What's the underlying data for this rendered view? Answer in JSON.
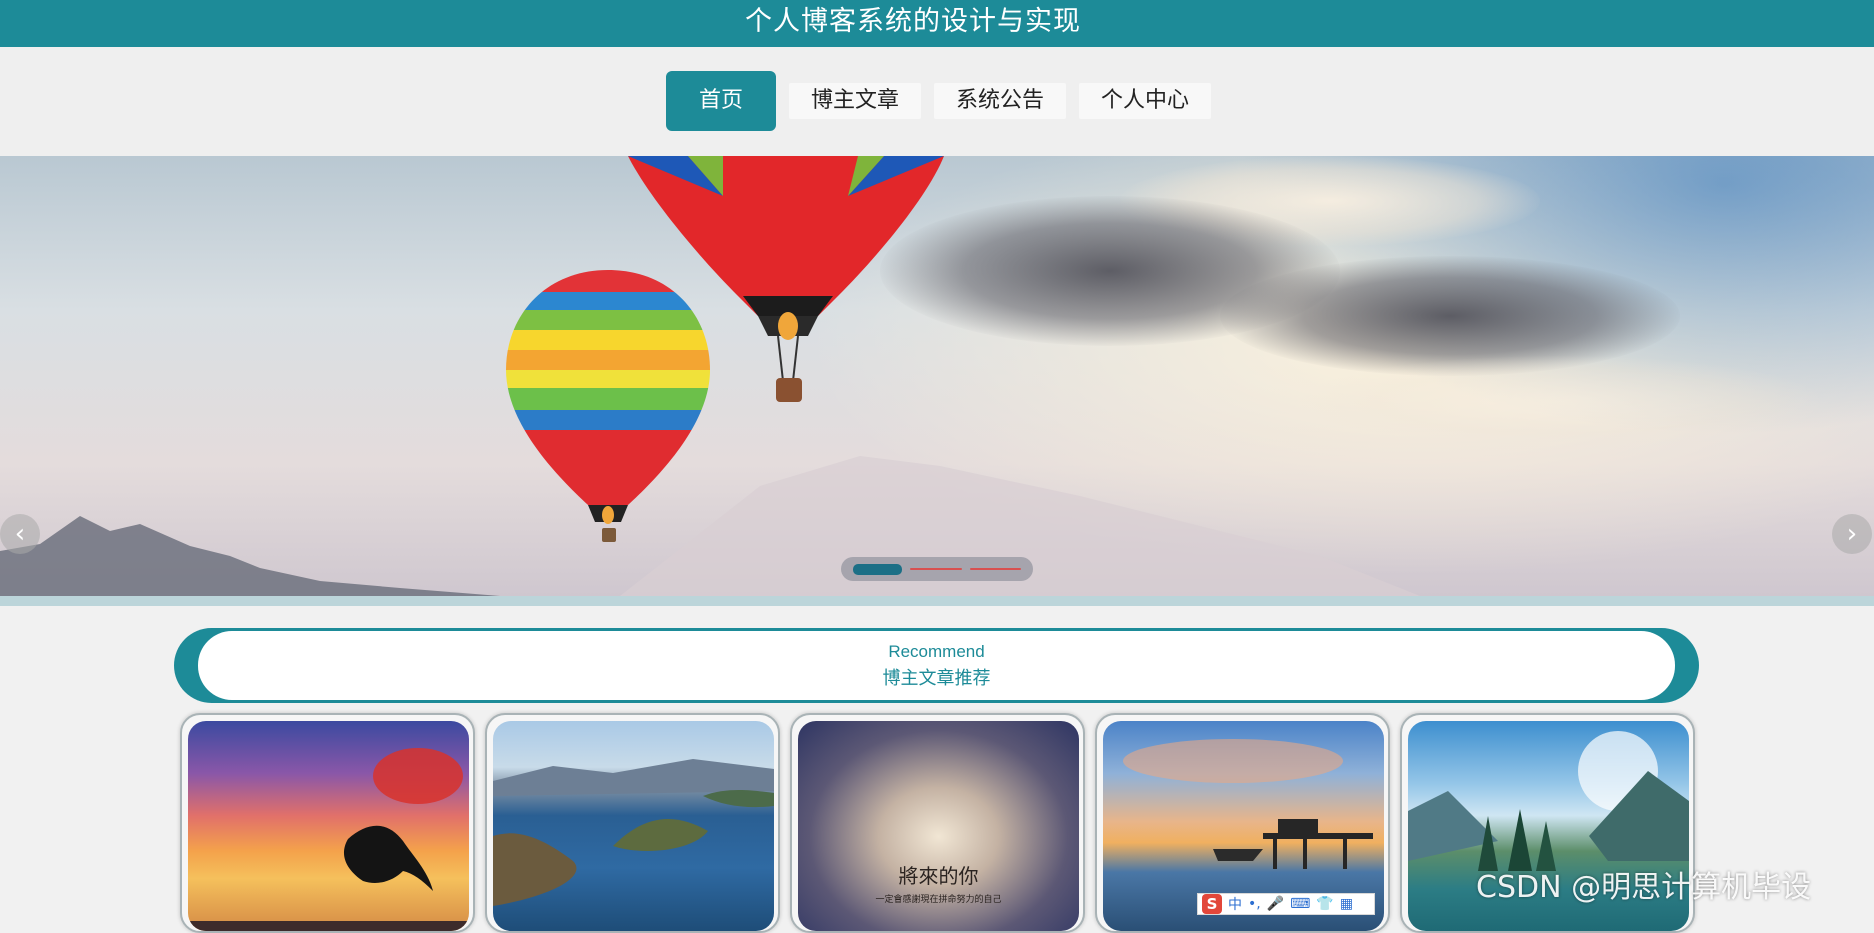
{
  "header": {
    "title": "个人博客系统的设计与实现"
  },
  "nav": {
    "items": [
      {
        "label": "首页"
      },
      {
        "label": "博主文章"
      },
      {
        "label": "系统公告"
      },
      {
        "label": "个人中心"
      }
    ],
    "active_index": 0
  },
  "banner": {
    "prev_icon": "chevron-left-icon",
    "next_icon": "chevron-right-icon",
    "prev_glyph": "‹",
    "next_glyph": "›",
    "slide_count": 3,
    "active_slide": 1
  },
  "recommend": {
    "title_en": "Recommend",
    "title_cn": "博主文章推荐"
  },
  "cards": [
    {
      "image": "dolphin-sunset-image"
    },
    {
      "image": "lake-islands-image"
    },
    {
      "image": "quote-sky-image",
      "caption": "將來的你",
      "subcaption": "一定會感謝現在拼命努力的自己"
    },
    {
      "image": "pier-sunset-image"
    },
    {
      "image": "mountain-lake-image"
    }
  ],
  "watermark": {
    "text": "CSDN @明思计算机毕设"
  },
  "ime": {
    "logo": "S",
    "lang": "中",
    "items": [
      "•,",
      "🎤",
      "⌨",
      "👕",
      "▦"
    ]
  },
  "colors": {
    "primary": "#1d8b98",
    "nav_active_text": "#ffffff"
  }
}
